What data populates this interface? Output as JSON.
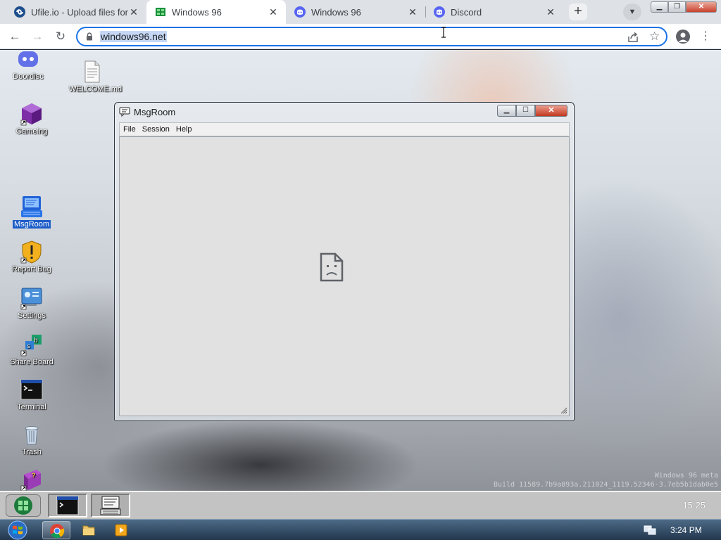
{
  "browser": {
    "tabs": [
      {
        "title": "Ufile.io - Upload files for",
        "icon": "ufile-icon",
        "active": false
      },
      {
        "title": "Windows 96",
        "icon": "windows96-icon",
        "active": true
      },
      {
        "title": "Windows 96",
        "icon": "discord-icon",
        "active": false
      },
      {
        "title": "Discord",
        "icon": "discord-icon",
        "active": false
      }
    ],
    "new_tab": "+",
    "address": "windows96.net",
    "colors": {
      "accent": "#1a73e8",
      "selection": "#c5d7f4",
      "tabstrip": "#dee1e6"
    }
  },
  "desktop": {
    "icons": [
      {
        "label": "Doordisc",
        "icon": "discord-icon"
      },
      {
        "label": "WELCOME.md",
        "icon": "document-icon"
      },
      {
        "label": "Gameing",
        "icon": "game-cube-icon"
      },
      {
        "label": "MsgRoom",
        "icon": "msgroom-icon",
        "selected": true
      },
      {
        "label": "Report Bug",
        "icon": "warning-shield-icon"
      },
      {
        "label": "Settings",
        "icon": "settings-icon"
      },
      {
        "label": "Share Board",
        "icon": "share-board-icon"
      },
      {
        "label": "Terminal",
        "icon": "terminal-icon"
      },
      {
        "label": "Trash",
        "icon": "trash-icon"
      },
      {
        "label": "",
        "icon": "help-book-icon"
      }
    ],
    "watermark": {
      "line1": "Windows 96 meta",
      "line2": "Build 11589.7b9a893a.211024_1119.52346-3.7eb5b1dab0e5"
    }
  },
  "msgroom_window": {
    "title": "MsgRoom",
    "menu": [
      "File",
      "Session",
      "Help"
    ],
    "content_icon": "sad-page-icon"
  },
  "w96_taskbar": {
    "clock": "15:25",
    "tasks": [
      "terminal-icon",
      "msgroom-icon"
    ]
  },
  "win7_taskbar": {
    "clock": "3:24 PM",
    "apps": [
      "chrome-icon",
      "explorer-folder-icon",
      "media-player-icon"
    ]
  }
}
